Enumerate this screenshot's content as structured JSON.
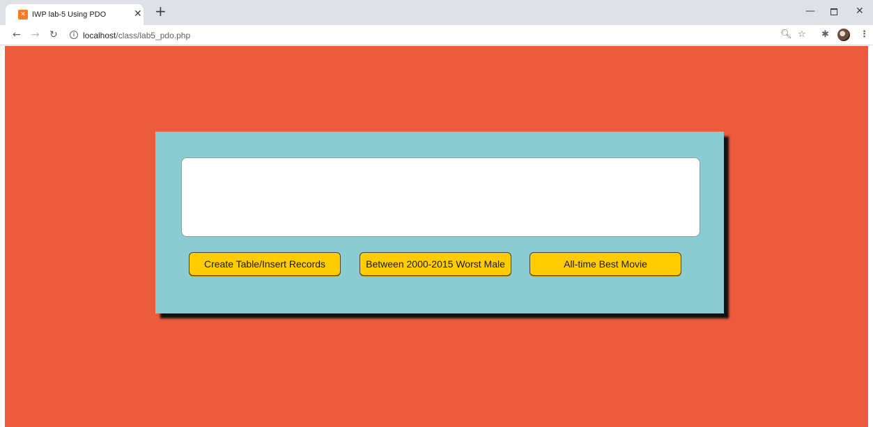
{
  "browser": {
    "tab_title": "IWP lab-5 Using PDO",
    "tab_favicon": "xampp-icon",
    "new_tab": "+",
    "url_host": "localhost",
    "url_path": "/class/lab5_pdo.php",
    "icons": [
      "back-icon",
      "forward-icon",
      "reload-icon",
      "info-icon",
      "zoom-icon",
      "star-icon",
      "extensions-icon",
      "avatar",
      "menu-icon",
      "minimize-icon",
      "maximize-icon",
      "close-icon"
    ]
  },
  "page": {
    "background_color": "#eb5b3c",
    "card_color": "#8bccd3",
    "button_color": "#ffcc00",
    "output_text": "",
    "buttons": [
      {
        "label": "Create Table/Insert Records"
      },
      {
        "label": "Between 2000-2015 Worst Male"
      },
      {
        "label": "All-time Best Movie"
      }
    ]
  }
}
